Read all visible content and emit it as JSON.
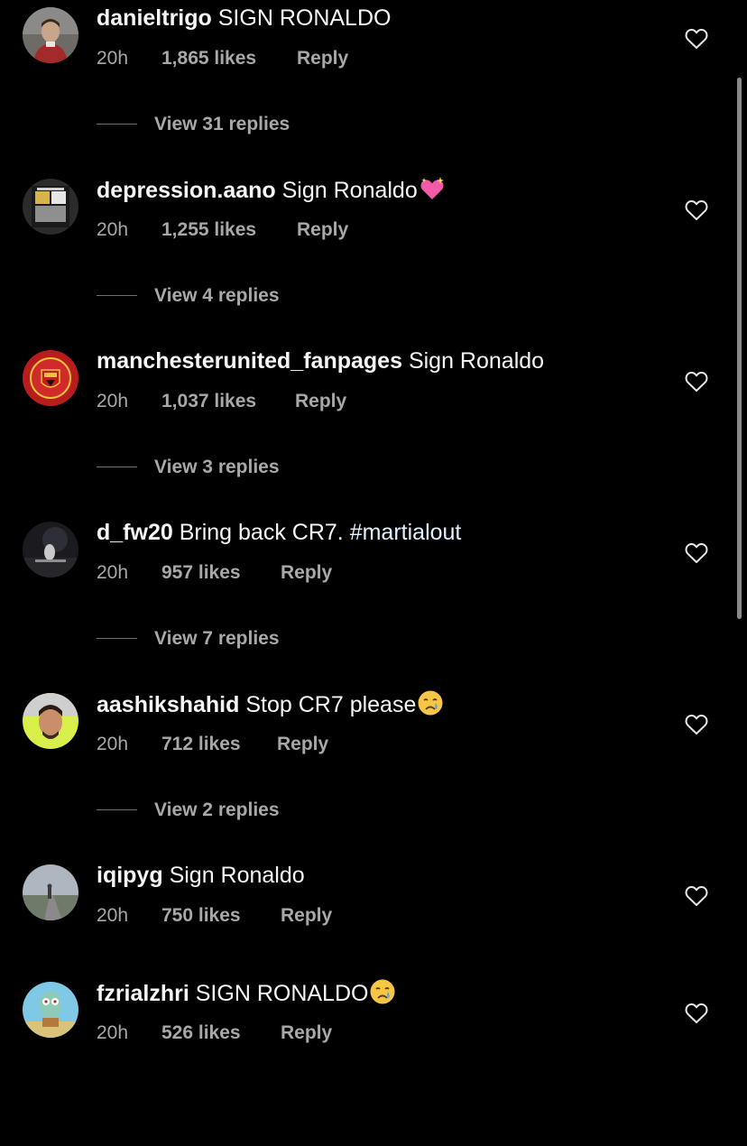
{
  "comments": [
    {
      "username": "danieltrigo",
      "text": "SIGN RONALDO",
      "time": "20h",
      "likes": "1,865 likes",
      "reply": "Reply",
      "view_replies": "View 31 replies",
      "avatar_icon": "avatar-photo-person-icon"
    },
    {
      "username": "depression.aano",
      "text": "Sign Ronaldo",
      "emoji": "sparkling-heart-emoji",
      "time": "20h",
      "likes": "1,255 likes",
      "reply": "Reply",
      "view_replies": "View 4 replies",
      "avatar_icon": "avatar-poster-icon"
    },
    {
      "username": "manchesterunited_fanpages",
      "text": "Sign Ronaldo",
      "time": "20h",
      "likes": "1,037 likes",
      "reply": "Reply",
      "view_replies": "View 3 replies",
      "avatar_icon": "avatar-club-crest-icon"
    },
    {
      "username": "d_fw20",
      "text": "Bring back CR7.",
      "hashtag": "#martialout",
      "time": "20h",
      "likes": "957 likes",
      "reply": "Reply",
      "view_replies": "View 7 replies",
      "avatar_icon": "avatar-night-photo-icon"
    },
    {
      "username": "aashikshahid",
      "text": "Stop CR7 please",
      "emoji": "crying-face-emoji",
      "time": "20h",
      "likes": "712 likes",
      "reply": "Reply",
      "view_replies": "View 2 replies",
      "avatar_icon": "avatar-selfie-icon"
    },
    {
      "username": "iqipyg",
      "text": "Sign Ronaldo",
      "time": "20h",
      "likes": "750 likes",
      "reply": "Reply",
      "avatar_icon": "avatar-road-photo-icon"
    },
    {
      "username": "fzrialzhri",
      "text": "SIGN RONALDO",
      "emoji": "crying-face-emoji",
      "time": "20h",
      "likes": "526 likes",
      "reply": "Reply",
      "avatar_icon": "avatar-cartoon-icon"
    }
  ],
  "like_icon": "heart-outline-icon",
  "colors": {
    "background": "#000000",
    "primary_text": "#f5f5f5",
    "secondary_text": "#a8a8a8",
    "hashtag": "#e0f1ff"
  }
}
